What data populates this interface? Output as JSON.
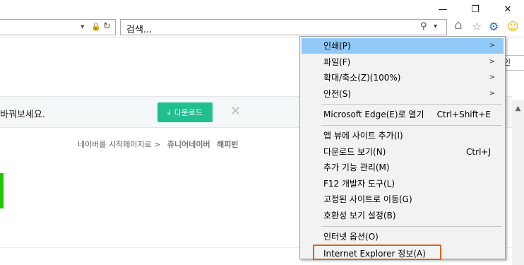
{
  "titlebar": {
    "minimize_icon": "minimize-icon",
    "maximize_icon": "restore-icon",
    "close_icon": "close-icon",
    "minimize_glyph": "—",
    "maximize_glyph": "❐",
    "close_glyph": "✕"
  },
  "address_bar": {
    "dropdown_glyph": "▾",
    "lock_glyph": "🔒",
    "refresh_glyph": "↻"
  },
  "search_box": {
    "text": "검색...",
    "search_glyph": "⚲",
    "dropdown_glyph": "▾"
  },
  "toolbar": {
    "home_glyph": "⌂",
    "favorites_glyph": "☆",
    "tools_glyph": "⚙",
    "feedback_glyph": "☺",
    "tools_color": "#1c6fc9",
    "feedback_color": "#e8b400"
  },
  "page": {
    "stub_button_label": "인",
    "banner_text": "바꿔보세요.",
    "download_label": "다운로드",
    "download_glyph": "⤓",
    "banner_close_glyph": "✕",
    "start_page_link": "네이버를 시작페이지로 >",
    "junior_link": "쥬니어네이버",
    "happybean_link": "해피빈",
    "accent_green": "#1ec800",
    "download_color": "#1fbf8f"
  },
  "menu": {
    "items": [
      {
        "label": "인쇄(P)",
        "shortcut": "",
        "submenu": true,
        "highlighted": true
      },
      {
        "label": "파일(F)",
        "shortcut": "",
        "submenu": true
      },
      {
        "label": "확대/축소(Z)(100%)",
        "shortcut": "",
        "submenu": true
      },
      {
        "label": "안전(S)",
        "shortcut": "",
        "submenu": true
      },
      {
        "label": "Microsoft Edge(E)로 열기",
        "shortcut": "Ctrl+Shift+E"
      },
      {
        "label": "앱 뷰에 사이트 추가(I)",
        "shortcut": ""
      },
      {
        "label": "다운로드 보기(N)",
        "shortcut": "Ctrl+J"
      },
      {
        "label": "추가 기능 관리(M)",
        "shortcut": ""
      },
      {
        "label": "F12 개발자 도구(L)",
        "shortcut": ""
      },
      {
        "label": "고정된 사이트로 이동(G)",
        "shortcut": ""
      },
      {
        "label": "호환성 보기 설정(B)",
        "shortcut": ""
      },
      {
        "label": "인터넷 옵션(O)",
        "shortcut": ""
      },
      {
        "label": "Internet Explorer 정보(A)",
        "shortcut": "",
        "boxed": true
      }
    ],
    "submenu_glyph": ">",
    "highlight_color": "#91c9f7",
    "box_color": "#d9651b"
  },
  "scrollbar": {
    "up_glyph": "▲"
  }
}
